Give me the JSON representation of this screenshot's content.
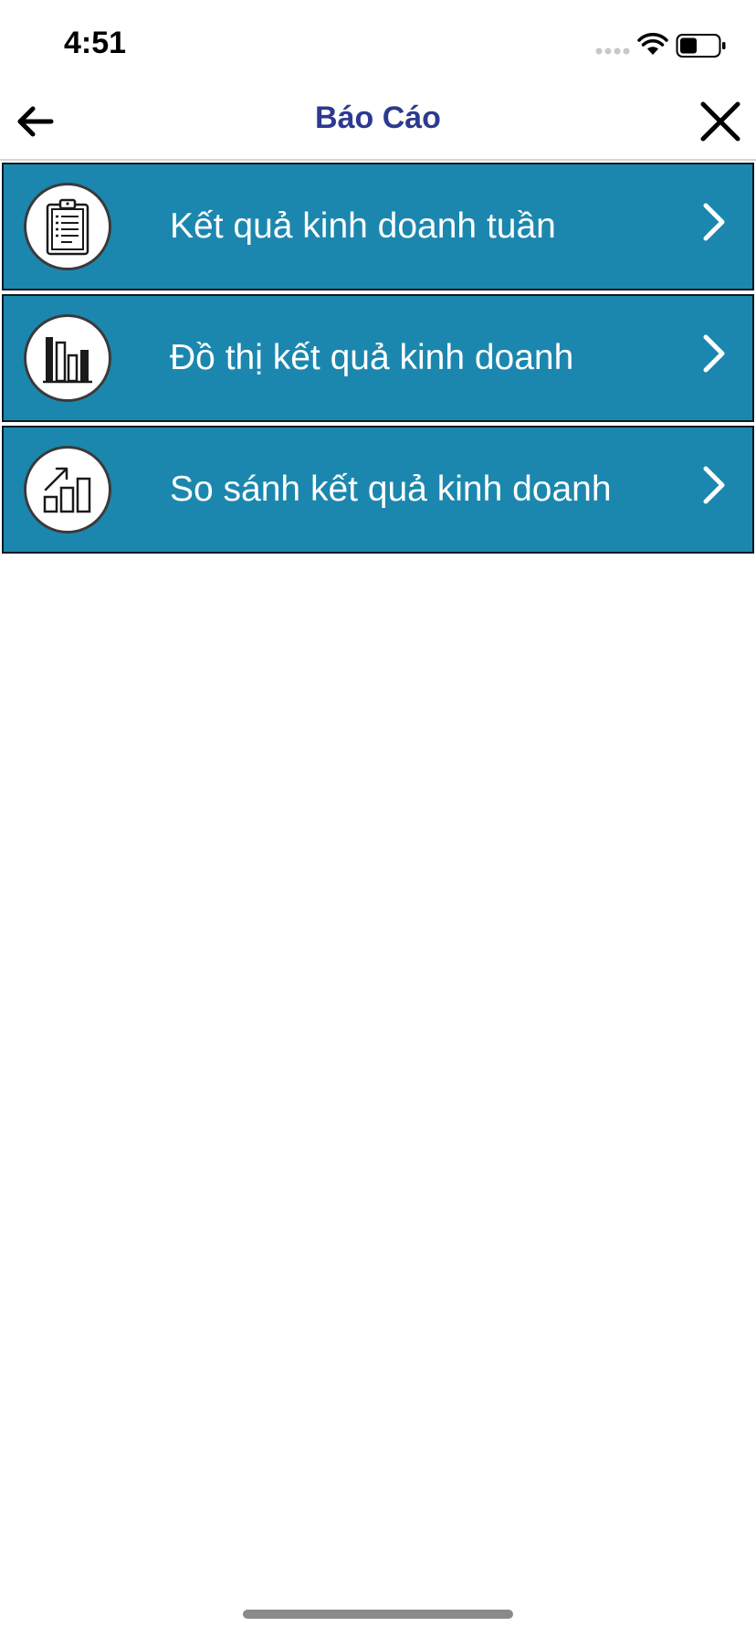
{
  "status_bar": {
    "time": "4:51"
  },
  "nav": {
    "title": "Báo Cáo",
    "back_icon": "back-arrow-icon",
    "close_icon": "close-icon"
  },
  "menu": {
    "items": [
      {
        "label": "Kết quả kinh doanh tuần",
        "icon": "clipboard-report-icon"
      },
      {
        "label": "Đồ thị kết quả kinh doanh",
        "icon": "bar-chart-icon"
      },
      {
        "label": "So sánh kết quả kinh doanh",
        "icon": "growth-chart-icon"
      }
    ]
  },
  "colors": {
    "item_background": "#1c87ae",
    "title": "#2e3a8f"
  }
}
